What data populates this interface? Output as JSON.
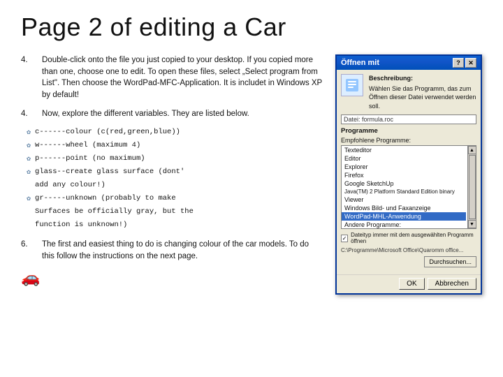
{
  "title": "Page 2 of editing a Car",
  "paragraphs": {
    "p4a": {
      "num": "4.",
      "text": "Double-click onto the file you just copied to your desktop. If you copied more than one, choose one to edit. To open these files, select „Select program from List\". Then choose the WordPad-MFC-Application. It is includet in Windows XP by default!"
    },
    "p4b": {
      "num": "4.",
      "text": "Now, explore the different variables. They are listed below."
    }
  },
  "code_lines": [
    {
      "icon": "✿",
      "text": "c------colour (c(red,green,blue))"
    },
    {
      "icon": "✿",
      "text": "w------wheel  (maximum 4)"
    },
    {
      "icon": "✿",
      "text": "p------point  (no maximum)"
    },
    {
      "icon": "✿",
      "text": "glass--create glass surface (dont'"
    },
    {
      "text": "add any colour!)"
    },
    {
      "icon": "✿",
      "text": "gr-----unknown (probably to make"
    },
    {
      "text": "Surfaces be officially gray, but the"
    },
    {
      "text": "function is unknown!)"
    }
  ],
  "p6": {
    "num": "6.",
    "text": "The first and easiest thing to do is changing colour of the car models. To do this follow the instructions on the next page."
  },
  "dialog": {
    "title": "Öffnen mit",
    "desc_label": "Beschreibung:",
    "desc_value": "Wählen Sie das Programm, das zum Öffnen dieser Datei verwendet werden soll.",
    "file_label": "Datei:",
    "file_value": "Datei: formula.roc",
    "programs_label": "Programme",
    "recommended_label": "Empfohlene Programme:",
    "list_items": [
      {
        "label": "Texteditor",
        "selected": false
      },
      {
        "label": "Editor",
        "selected": false
      },
      {
        "label": "Explorer",
        "selected": false
      },
      {
        "label": "Firefox",
        "selected": false
      },
      {
        "label": "Google SketchUp",
        "selected": false
      },
      {
        "label": "Java(TM) 2 Platform Standard Edition binary",
        "selected": false
      },
      {
        "label": "Viewer",
        "selected": false
      },
      {
        "label": "Windows Bild- und Faxanzeige",
        "selected": false
      },
      {
        "label": "WordPad-MHL-Anwendung",
        "selected": true
      },
      {
        "label": "Andere Programme:",
        "selected": false
      }
    ],
    "checkbox_label": "Dateityp immer mit dem ausgewählten Programm öffnen",
    "path_text": "C:\\Programme\\Microsoft Office\\Quaromm office...",
    "browse_btn": "Durchsuchen...",
    "ok_btn": "OK",
    "cancel_btn": "Abbrechen",
    "title_controls": {
      "minimize": "—",
      "maximize": "□",
      "close": "✕"
    }
  }
}
